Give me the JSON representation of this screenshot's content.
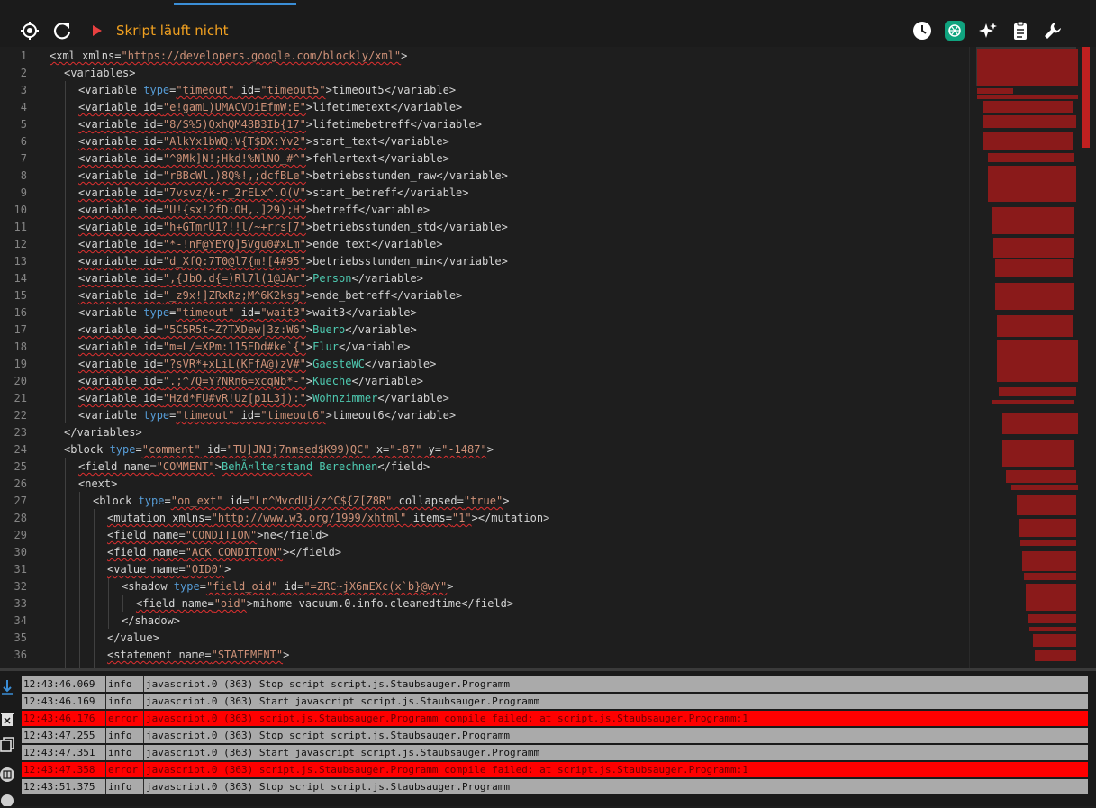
{
  "toolbar": {
    "status_text": "Skript läuft nicht",
    "status_color": "#f0a020",
    "icons": [
      "target-icon",
      "refresh-icon",
      "play-icon",
      "clock-icon",
      "openai-icon",
      "sparkles-icon",
      "clipboard-icon",
      "wrench-icon"
    ]
  },
  "editor": {
    "line_numbers": [
      "1",
      "2",
      "3",
      "4",
      "5",
      "6",
      "7",
      "8",
      "9",
      "10",
      "11",
      "12",
      "13",
      "14",
      "15",
      "16",
      "17",
      "18",
      "19",
      "20",
      "21",
      "22",
      "23",
      "24",
      "25",
      "26",
      "27",
      "28",
      "29",
      "30",
      "31",
      "32",
      "33",
      "34",
      "35",
      "36"
    ]
  },
  "code": {
    "l1": {
      "open": "<xml xmlns=",
      "url": "\"https://developers.google.com/blockly/xml\"",
      "close": ">"
    },
    "l2": {
      "text": "<variables>"
    },
    "l3": {
      "open": "<variable ",
      "attr1": "type",
      "eq1": "=",
      "val1": "\"timeout\"",
      "attr2": " id=",
      "val2": "\"timeout5\"",
      "close": ">",
      "content": "timeout5",
      "end": "</variable>"
    },
    "l4": {
      "open": "<variable id=",
      "val": "\"e!gamL)UMACVDiEfmW:E\"",
      "close": ">",
      "content": "lifetimetext",
      "end": "</variable>"
    },
    "l5": {
      "open": "<variable id=",
      "val": "\"8/S%5)QxhQM48B3Ib{17\"",
      "close": ">",
      "content": "lifetimebetreff",
      "end": "</variable>"
    },
    "l6": {
      "open": "<variable id=",
      "val": "\"AlkYx1bWQ:V{T$DX:Yv2\"",
      "close": ">",
      "content": "start_text",
      "end": "</variable>"
    },
    "l7": {
      "open": "<variable id=",
      "val": "\"^0Mk]N!;Hkd!%NlNO_#^\"",
      "close": ">",
      "content": "fehlertext",
      "end": "</variable>"
    },
    "l8": {
      "open": "<variable id=",
      "val": "\"rBBcWl.)8Q%!,;dcfBLe\"",
      "close": ">",
      "content": "betriebsstunden_raw",
      "end": "</variable>"
    },
    "l9": {
      "open": "<variable id=",
      "val": "\"7vsvz/k-r_2rELx^.O(V\"",
      "close": ">",
      "content": "start_betreff",
      "end": "</variable>"
    },
    "l10": {
      "open": "<variable id=",
      "val": "\"U!{sx!2fD:OH,.]29);H\"",
      "close": ">",
      "content": "betreff",
      "end": "</variable>"
    },
    "l11": {
      "open": "<variable id=",
      "val": "\"h+GTmrU1?!!l/~+rrs[7\"",
      "close": ">",
      "content": "betriebsstunden_std",
      "end": "</variable>"
    },
    "l12": {
      "open": "<variable id=",
      "val": "\"*-!nF@YEYQ]5Vgu0#xLm\"",
      "close": ">",
      "content": "ende_text",
      "end": "</variable>"
    },
    "l13": {
      "open": "<variable id=",
      "val": "\"d_XfQ:7T0@l7{m![4#95\"",
      "close": ">",
      "content": "betriebsstunden_min",
      "end": "</variable>"
    },
    "l14": {
      "open": "<variable id=",
      "val": "\",{JbO.d{=)Rl7l(1@JAr\"",
      "close": ">",
      "content": "Person",
      "end": "</variable>"
    },
    "l15": {
      "open": "<variable id=",
      "val": "\"_z9x!]ZRxRz;M^6K2ksg\"",
      "close": ">",
      "content": "ende_betreff",
      "end": "</variable>"
    },
    "l16": {
      "open": "<variable ",
      "attr1": "type",
      "eq1": "=",
      "val1": "\"timeout\"",
      "attr2": " id=",
      "val2": "\"wait3\"",
      "close": ">",
      "content": "wait3",
      "end": "</variable>"
    },
    "l17": {
      "open": "<variable id=",
      "val": "\"5C5R5t~Z?TXDew|3z:W6\"",
      "close": ">",
      "content": "Buero",
      "end": "</variable>"
    },
    "l18": {
      "open": "<variable id=",
      "val": "\"m=L/=XPm:115EDd#ke`{\"",
      "close": ">",
      "content": "Flur",
      "end": "</variable>"
    },
    "l19": {
      "open": "<variable id=",
      "val": "\"?sVR*+xLiL(KFfA@)zV#\"",
      "close": ">",
      "content": "GaesteWC",
      "end": "</variable>"
    },
    "l20": {
      "open": "<variable id=",
      "val": "\".;^7Q=Y?NRn6=xcqNb*-\"",
      "close": ">",
      "content": "Kueche",
      "end": "</variable>"
    },
    "l21": {
      "open": "<variable id=",
      "val": "\"Hzd*FU#vR!Uz[p1L3j):\"",
      "close": ">",
      "content": "Wohnzimmer",
      "end": "</variable>"
    },
    "l22": {
      "open": "<variable ",
      "attr1": "type",
      "eq1": "=",
      "val1": "\"timeout\"",
      "attr2": " id=",
      "val2": "\"timeout6\"",
      "close": ">",
      "content": "timeout6",
      "end": "</variable>"
    },
    "l23": {
      "text": "</variables>"
    },
    "l24": {
      "open": "<block ",
      "attr1": "type",
      "eq1": "=",
      "val1": "\"comment\"",
      "attr2": " id=",
      "val2": "\"TU]JNJj7nmsed$K99)QC\"",
      "attr3": " x=",
      "val3": "\"-87\"",
      "attr4": " y=",
      "val4": "\"-1487\"",
      "close": ">"
    },
    "l25": {
      "open": "<field name=",
      "val": "\"COMMENT\"",
      "close": ">",
      "content_a": "BehÃ¤lterstand",
      "content_b": " Berechnen",
      "end": "</field>"
    },
    "l26": {
      "text": "<next>"
    },
    "l27": {
      "open": "<block ",
      "attr1": "type",
      "eq1": "=",
      "val1": "\"on_ext\"",
      "attr2": " id=",
      "val2": "\"Ln^MvcdUj/z^C${Z[Z8R\"",
      "attr3": " collapsed=",
      "val3": "\"true\"",
      "close": ">"
    },
    "l28": {
      "open": "<mutation xmlns=",
      "url": "\"http://www.w3.org/1999/xhtml\"",
      "attr2": " items=",
      "val2": "\"1\"",
      "close": "></mutation>"
    },
    "l29": {
      "open": "<field name=",
      "val": "\"CONDITION\"",
      "close": ">",
      "content": "ne",
      "end": "</field>"
    },
    "l30": {
      "open": "<field name=",
      "val": "\"ACK_CONDITION\"",
      "close": "></field>"
    },
    "l31": {
      "open": "<value name=",
      "val": "\"OID0\"",
      "close": ">"
    },
    "l32": {
      "open": "<shadow ",
      "attr1": "type",
      "eq1": "=",
      "val1": "\"field_oid\"",
      "attr2": " id=",
      "val2": "\"=ZRC~jX6mEXc(x`b}@wY\"",
      "close": ">"
    },
    "l33": {
      "open": "<field name=",
      "val": "\"oid\"",
      "close": ">",
      "content": "mihome-vacuum.0.info.cleanedtime",
      "end": "</field>"
    },
    "l34": {
      "text": "</shadow>"
    },
    "l35": {
      "text": "</value>"
    },
    "l36": {
      "open": "<statement name=",
      "val": "\"STATEMENT\"",
      "close": ">"
    }
  },
  "log": [
    {
      "time": "12:43:46.069",
      "severity": "info",
      "message": "javascript.0 (363) Stop script script.js.Staubsauger.Programm"
    },
    {
      "time": "12:43:46.169",
      "severity": "info",
      "message": "javascript.0 (363) Start javascript script.js.Staubsauger.Programm"
    },
    {
      "time": "12:43:46.176",
      "severity": "error",
      "message": "javascript.0 (363) script.js.Staubsauger.Programm compile failed: at script.js.Staubsauger.Programm:1"
    },
    {
      "time": "12:43:47.255",
      "severity": "info",
      "message": "javascript.0 (363) Stop script script.js.Staubsauger.Programm"
    },
    {
      "time": "12:43:47.351",
      "severity": "info",
      "message": "javascript.0 (363) Start javascript script.js.Staubsauger.Programm"
    },
    {
      "time": "12:43:47.358",
      "severity": "error",
      "message": "javascript.0 (363) script.js.Staubsauger.Programm compile failed: at script.js.Staubsauger.Programm:1"
    },
    {
      "time": "12:43:51.375",
      "severity": "info",
      "message": "javascript.0 (363) Stop script script.js.Staubsauger.Programm"
    }
  ],
  "colors": {
    "error_row": "#ff0000",
    "info_row": "#aaaaaa",
    "accent": "#3b8ed6"
  }
}
